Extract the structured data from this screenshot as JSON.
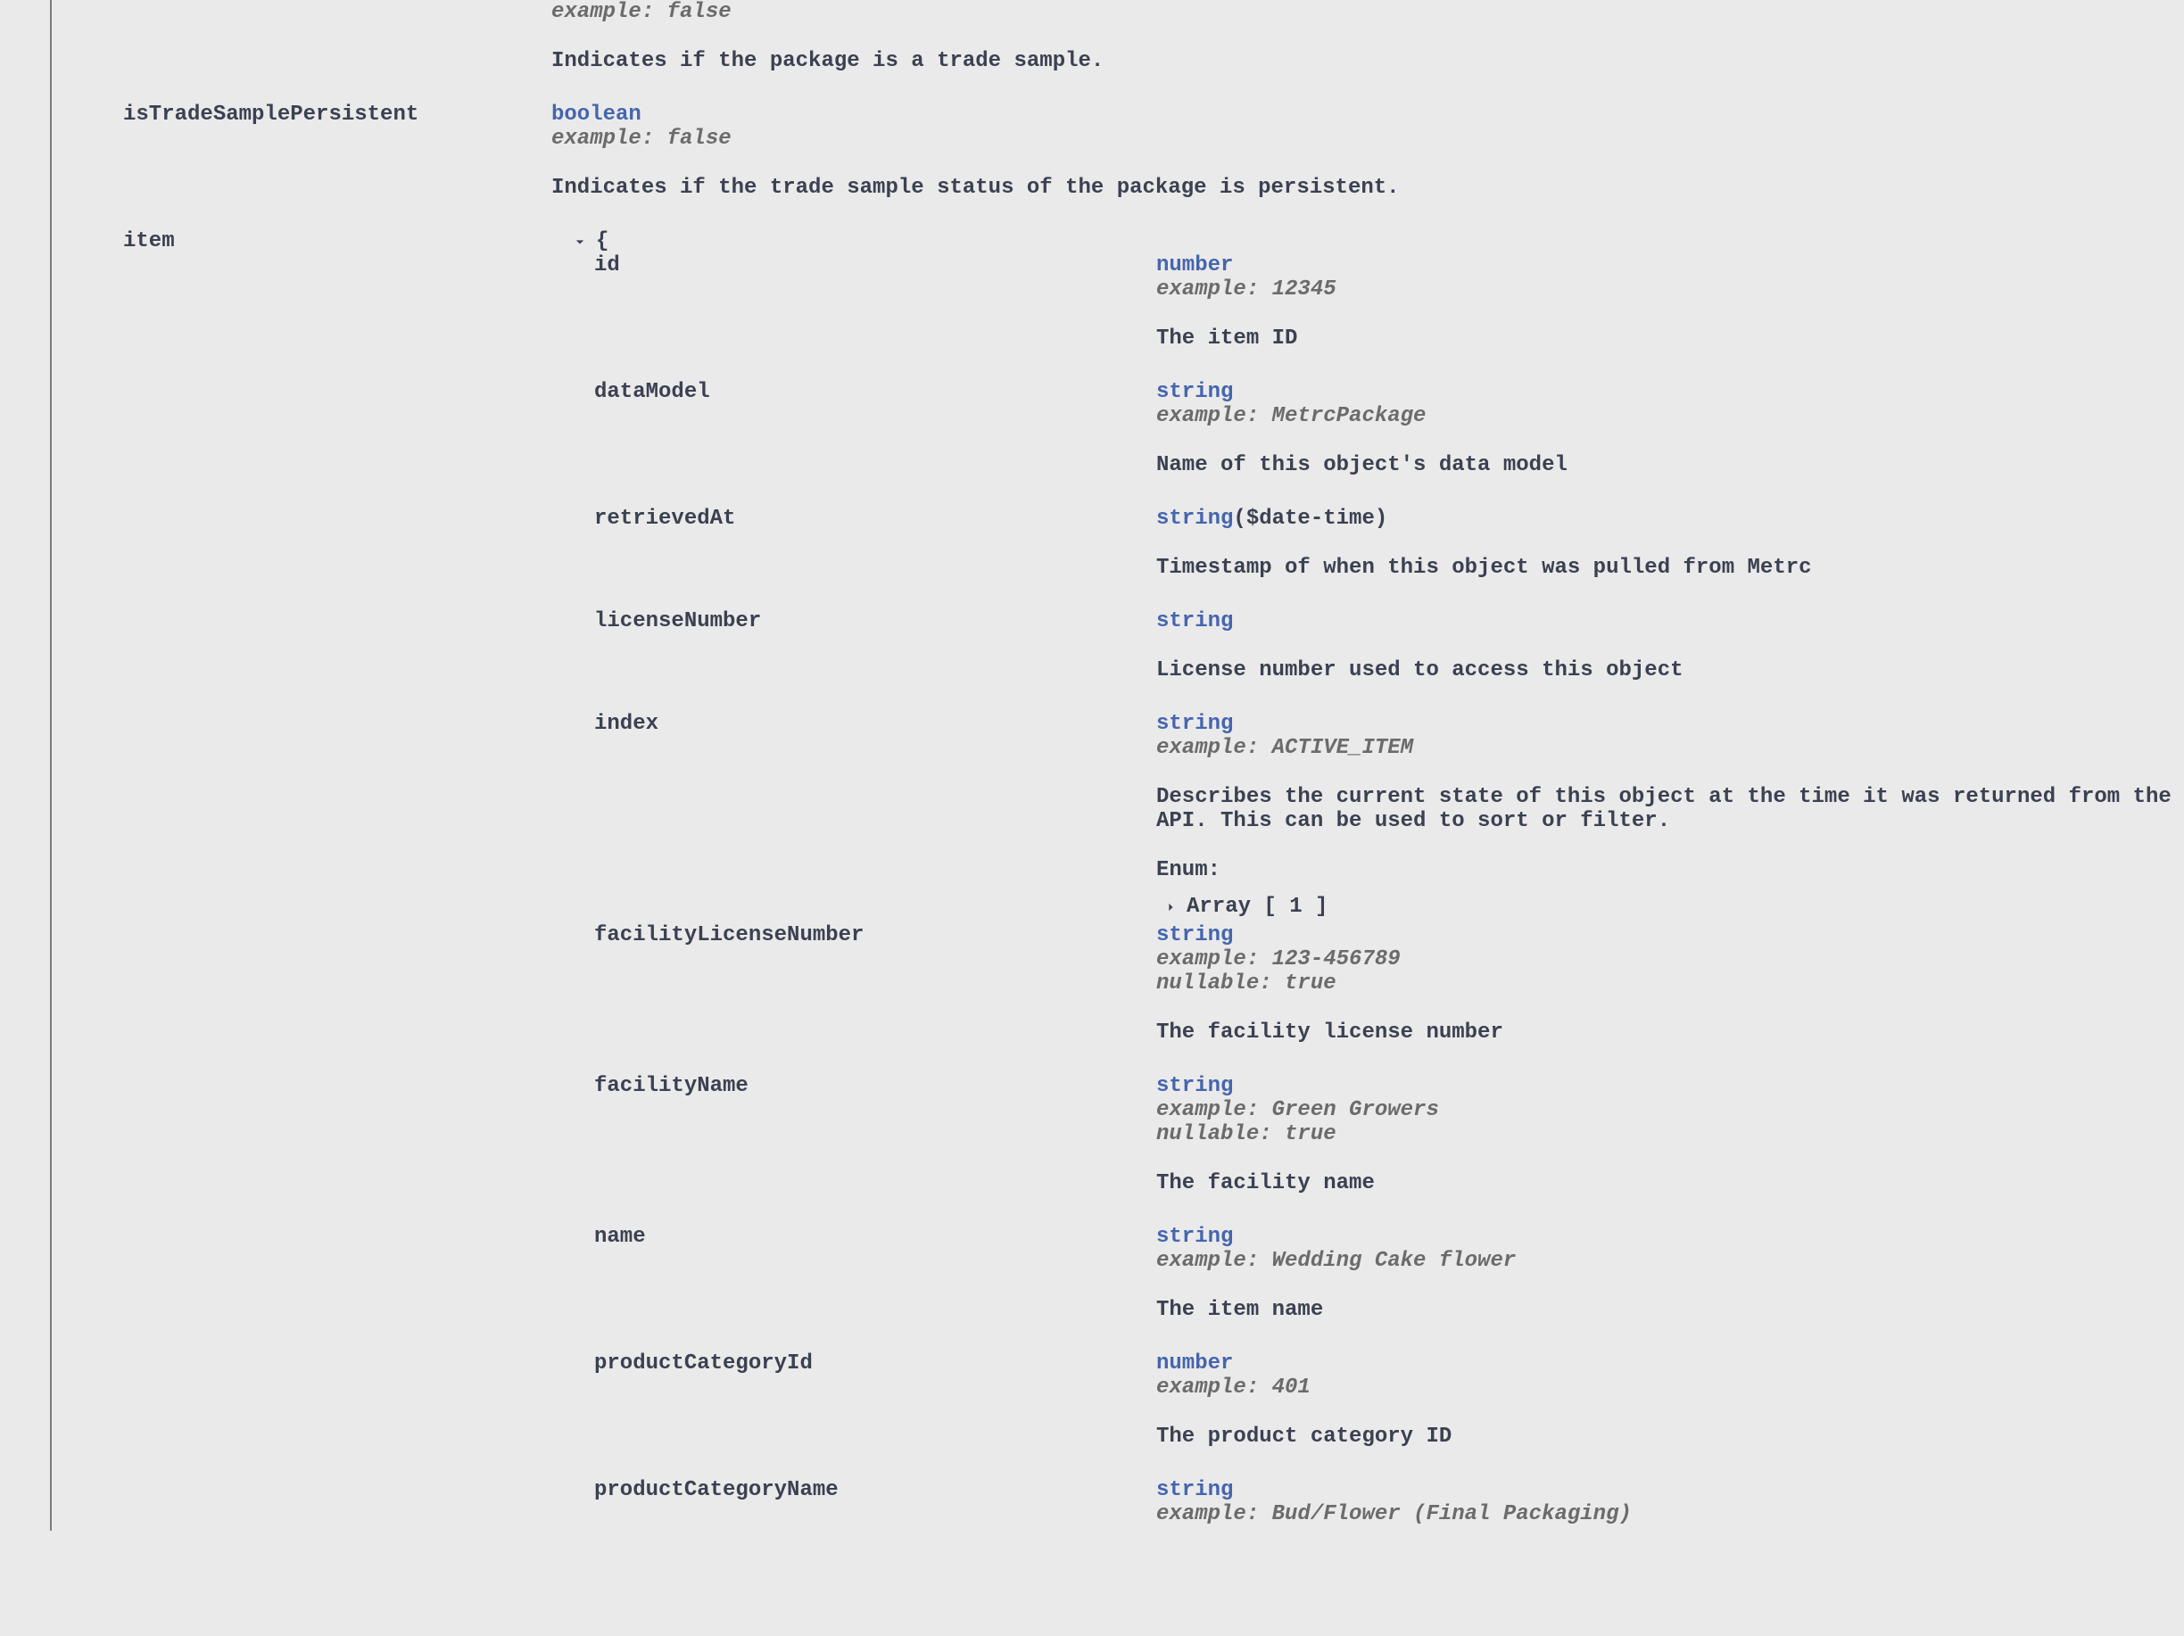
{
  "topProperties": {
    "isTradeSamplePrev": {
      "type": "",
      "example": "example: false",
      "description": "Indicates if the package is a trade sample."
    },
    "isTradeSamplePersistent": {
      "name": "isTradeSamplePersistent",
      "type": "boolean",
      "example": "example: false",
      "description": "Indicates if the trade sample status of the package is persistent."
    }
  },
  "item": {
    "name": "item",
    "brace": "{",
    "properties": {
      "id": {
        "name": "id",
        "type": "number",
        "example": "example: 12345",
        "description": "The item ID"
      },
      "dataModel": {
        "name": "dataModel",
        "type": "string",
        "example": "example: MetrcPackage",
        "description": "Name of this object's data model"
      },
      "retrievedAt": {
        "name": "retrievedAt",
        "type": "string",
        "format": "($date-time)",
        "description": "Timestamp of when this object was pulled from Metrc"
      },
      "licenseNumber": {
        "name": "licenseNumber",
        "type": "string",
        "description": "License number used to access this object"
      },
      "index": {
        "name": "index",
        "type": "string",
        "example": "example: ACTIVE_ITEM",
        "description": "Describes the current state of this object at the time it was returned from the API. This can be used to sort or filter.",
        "enumLabel": "Enum:",
        "enumArray": "Array [ 1 ]"
      },
      "facilityLicenseNumber": {
        "name": "facilityLicenseNumber",
        "type": "string",
        "example": "example: 123-456789",
        "nullable": "nullable: true",
        "description": "The facility license number"
      },
      "facilityName": {
        "name": "facilityName",
        "type": "string",
        "example": "example: Green Growers",
        "nullable": "nullable: true",
        "description": "The facility name"
      },
      "name": {
        "name": "name",
        "type": "string",
        "example": "example: Wedding Cake flower",
        "description": "The item name"
      },
      "productCategoryId": {
        "name": "productCategoryId",
        "type": "number",
        "example": "example: 401",
        "description": "The product category ID"
      },
      "productCategoryName": {
        "name": "productCategoryName",
        "type": "string",
        "example": "example: Bud/Flower (Final Packaging)",
        "description": ""
      }
    }
  }
}
